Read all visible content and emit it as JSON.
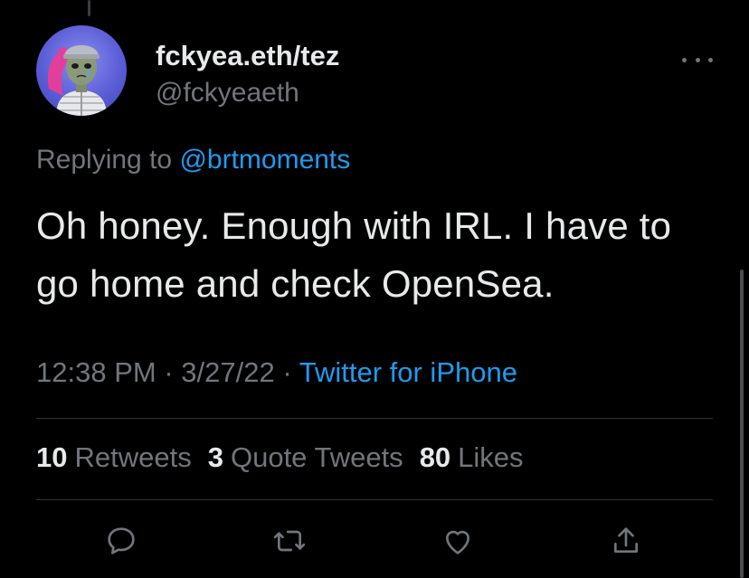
{
  "tweet": {
    "display_name": "fckyea.eth/tez",
    "handle": "@fckyeaeth",
    "replying_prefix": "Replying to",
    "replying_to": "@brtmoments",
    "text_line1": "Oh honey. Enough with IRL. I have to",
    "text_line2": "go home and check OpenSea.",
    "time": "12:38 PM",
    "date": "3/27/22",
    "separator": "·",
    "source": "Twitter for iPhone"
  },
  "stats": {
    "retweets_count": "10",
    "retweets_label": "Retweets",
    "quotes_count": "3",
    "quotes_label": "Quote Tweets",
    "likes_count": "80",
    "likes_label": "Likes"
  },
  "actions": {
    "reply_icon": "reply-bubble-icon",
    "retweet_icon": "retweet-icon",
    "like_icon": "heart-icon",
    "share_icon": "share-upload-icon"
  },
  "colors": {
    "background": "#000000",
    "primary_text": "#e7e9ea",
    "secondary_text": "#71767b",
    "accent": "#1d9bf0",
    "divider": "#2f3336"
  }
}
